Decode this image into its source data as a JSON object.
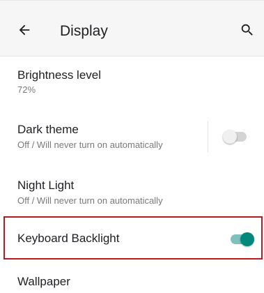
{
  "header": {
    "title": "Display",
    "back_icon": "arrow-back-icon",
    "search_icon": "search-icon"
  },
  "settings": [
    {
      "title": "Brightness level",
      "summary": "72%"
    },
    {
      "title": "Dark theme",
      "summary": "Off / Will never turn on automatically",
      "toggle": "off"
    },
    {
      "title": "Night Light",
      "summary": "Off / Will never turn on automatically"
    },
    {
      "title": "Keyboard Backlight",
      "toggle": "on"
    },
    {
      "title": "Wallpaper"
    }
  ],
  "colors": {
    "accent": "#00897b",
    "accent_track": "#7fc2bd",
    "highlight_border": "#b71c1c",
    "toolbar_background": "#f6f6f6"
  }
}
